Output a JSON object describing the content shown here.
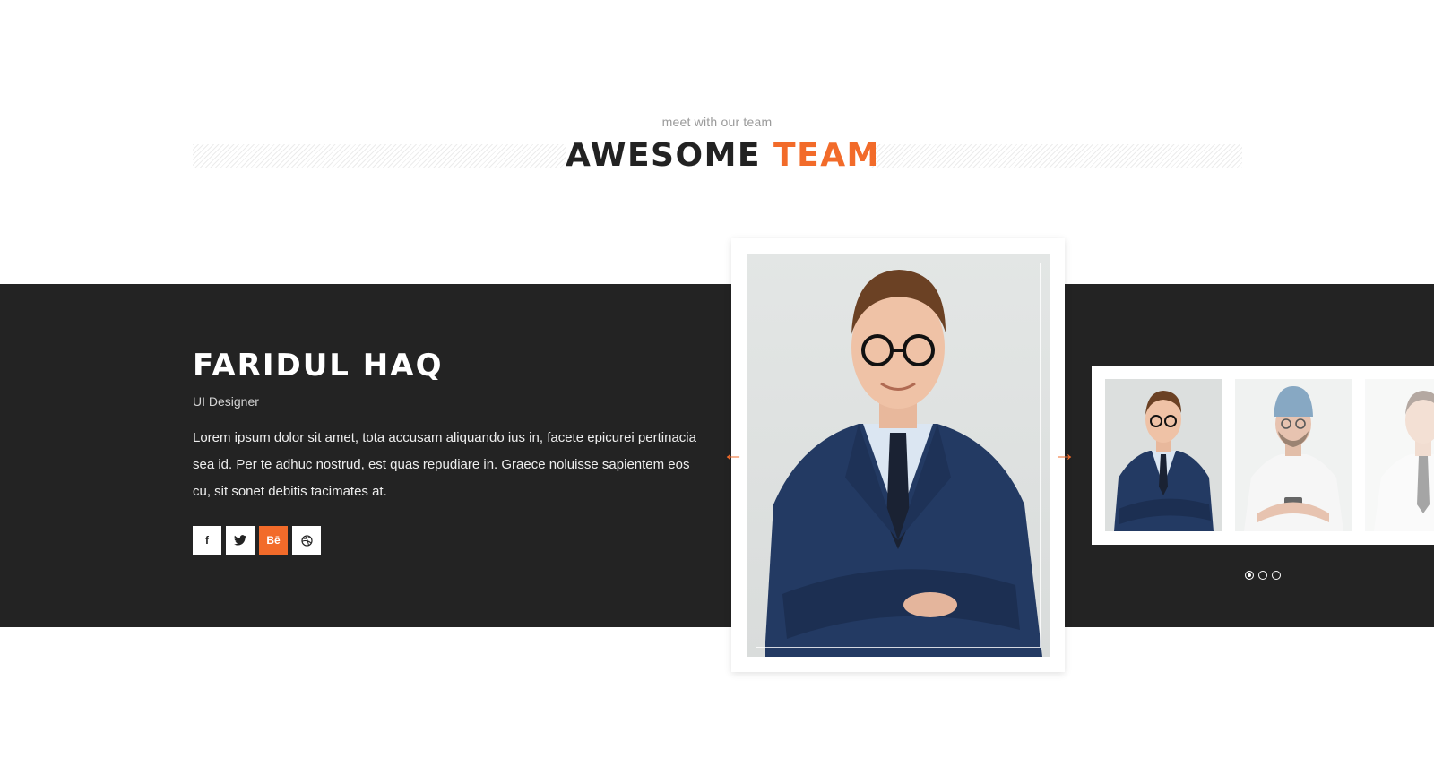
{
  "section": {
    "subtitle": "meet with our team",
    "title_main": "AWESOME",
    "title_accent": "TEAM"
  },
  "member": {
    "name": "FARIDUL HAQ",
    "role": "UI Designer",
    "bio": "Lorem ipsum dolor sit amet, tota accusam aliquando ius in, facete epicurei pertinacia sea id. Per te adhuc nostrud, est quas repudiare in. Graece noluisse sapientem eos cu, sit sonet debitis tacimates at."
  },
  "social": [
    {
      "label": "f",
      "icon": "facebook-icon"
    },
    {
      "label": "🐦",
      "icon": "twitter-icon"
    },
    {
      "label": "Bē",
      "icon": "behance-icon",
      "active": true
    },
    {
      "label": "◎",
      "icon": "dribbble-icon"
    }
  ],
  "carousel": {
    "prev_symbol": "←",
    "next_symbol": "→",
    "thumbnails": [
      "man-in-suit-photo",
      "man-in-beanie-photo",
      "man-in-shirt-photo"
    ],
    "page_count": 3,
    "active_page": 1
  },
  "colors": {
    "accent": "#f26b2a",
    "dark_band": "#232323",
    "title_dark": "#222222"
  }
}
